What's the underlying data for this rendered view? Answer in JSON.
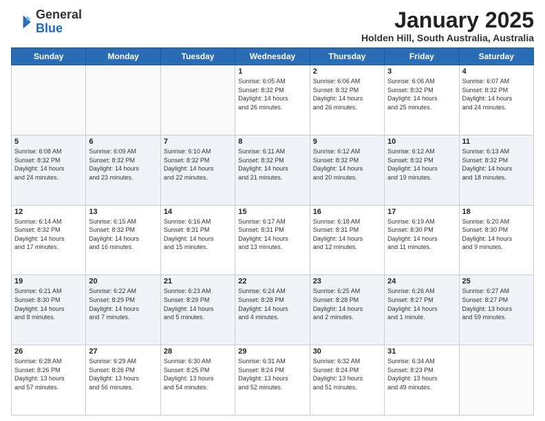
{
  "logo": {
    "general": "General",
    "blue": "Blue"
  },
  "title": "January 2025",
  "location": "Holden Hill, South Australia, Australia",
  "days_of_week": [
    "Sunday",
    "Monday",
    "Tuesday",
    "Wednesday",
    "Thursday",
    "Friday",
    "Saturday"
  ],
  "weeks": [
    [
      {
        "day": "",
        "info": ""
      },
      {
        "day": "",
        "info": ""
      },
      {
        "day": "",
        "info": ""
      },
      {
        "day": "1",
        "info": "Sunrise: 6:05 AM\nSunset: 8:32 PM\nDaylight: 14 hours\nand 26 minutes."
      },
      {
        "day": "2",
        "info": "Sunrise: 6:06 AM\nSunset: 8:32 PM\nDaylight: 14 hours\nand 26 minutes."
      },
      {
        "day": "3",
        "info": "Sunrise: 6:06 AM\nSunset: 8:32 PM\nDaylight: 14 hours\nand 25 minutes."
      },
      {
        "day": "4",
        "info": "Sunrise: 6:07 AM\nSunset: 8:32 PM\nDaylight: 14 hours\nand 24 minutes."
      }
    ],
    [
      {
        "day": "5",
        "info": "Sunrise: 6:08 AM\nSunset: 8:32 PM\nDaylight: 14 hours\nand 24 minutes."
      },
      {
        "day": "6",
        "info": "Sunrise: 6:09 AM\nSunset: 8:32 PM\nDaylight: 14 hours\nand 23 minutes."
      },
      {
        "day": "7",
        "info": "Sunrise: 6:10 AM\nSunset: 8:32 PM\nDaylight: 14 hours\nand 22 minutes."
      },
      {
        "day": "8",
        "info": "Sunrise: 6:11 AM\nSunset: 8:32 PM\nDaylight: 14 hours\nand 21 minutes."
      },
      {
        "day": "9",
        "info": "Sunrise: 6:12 AM\nSunset: 8:32 PM\nDaylight: 14 hours\nand 20 minutes."
      },
      {
        "day": "10",
        "info": "Sunrise: 6:12 AM\nSunset: 8:32 PM\nDaylight: 14 hours\nand 19 minutes."
      },
      {
        "day": "11",
        "info": "Sunrise: 6:13 AM\nSunset: 8:32 PM\nDaylight: 14 hours\nand 18 minutes."
      }
    ],
    [
      {
        "day": "12",
        "info": "Sunrise: 6:14 AM\nSunset: 8:32 PM\nDaylight: 14 hours\nand 17 minutes."
      },
      {
        "day": "13",
        "info": "Sunrise: 6:15 AM\nSunset: 8:32 PM\nDaylight: 14 hours\nand 16 minutes."
      },
      {
        "day": "14",
        "info": "Sunrise: 6:16 AM\nSunset: 8:31 PM\nDaylight: 14 hours\nand 15 minutes."
      },
      {
        "day": "15",
        "info": "Sunrise: 6:17 AM\nSunset: 8:31 PM\nDaylight: 14 hours\nand 13 minutes."
      },
      {
        "day": "16",
        "info": "Sunrise: 6:18 AM\nSunset: 8:31 PM\nDaylight: 14 hours\nand 12 minutes."
      },
      {
        "day": "17",
        "info": "Sunrise: 6:19 AM\nSunset: 8:30 PM\nDaylight: 14 hours\nand 11 minutes."
      },
      {
        "day": "18",
        "info": "Sunrise: 6:20 AM\nSunset: 8:30 PM\nDaylight: 14 hours\nand 9 minutes."
      }
    ],
    [
      {
        "day": "19",
        "info": "Sunrise: 6:21 AM\nSunset: 8:30 PM\nDaylight: 14 hours\nand 8 minutes."
      },
      {
        "day": "20",
        "info": "Sunrise: 6:22 AM\nSunset: 8:29 PM\nDaylight: 14 hours\nand 7 minutes."
      },
      {
        "day": "21",
        "info": "Sunrise: 6:23 AM\nSunset: 8:29 PM\nDaylight: 14 hours\nand 5 minutes."
      },
      {
        "day": "22",
        "info": "Sunrise: 6:24 AM\nSunset: 8:28 PM\nDaylight: 14 hours\nand 4 minutes."
      },
      {
        "day": "23",
        "info": "Sunrise: 6:25 AM\nSunset: 8:28 PM\nDaylight: 14 hours\nand 2 minutes."
      },
      {
        "day": "24",
        "info": "Sunrise: 6:26 AM\nSunset: 8:27 PM\nDaylight: 14 hours\nand 1 minute."
      },
      {
        "day": "25",
        "info": "Sunrise: 6:27 AM\nSunset: 8:27 PM\nDaylight: 13 hours\nand 59 minutes."
      }
    ],
    [
      {
        "day": "26",
        "info": "Sunrise: 6:28 AM\nSunset: 8:26 PM\nDaylight: 13 hours\nand 57 minutes."
      },
      {
        "day": "27",
        "info": "Sunrise: 6:29 AM\nSunset: 8:26 PM\nDaylight: 13 hours\nand 56 minutes."
      },
      {
        "day": "28",
        "info": "Sunrise: 6:30 AM\nSunset: 8:25 PM\nDaylight: 13 hours\nand 54 minutes."
      },
      {
        "day": "29",
        "info": "Sunrise: 6:31 AM\nSunset: 8:24 PM\nDaylight: 13 hours\nand 52 minutes."
      },
      {
        "day": "30",
        "info": "Sunrise: 6:32 AM\nSunset: 8:24 PM\nDaylight: 13 hours\nand 51 minutes."
      },
      {
        "day": "31",
        "info": "Sunrise: 6:34 AM\nSunset: 8:23 PM\nDaylight: 13 hours\nand 49 minutes."
      },
      {
        "day": "",
        "info": ""
      }
    ]
  ]
}
